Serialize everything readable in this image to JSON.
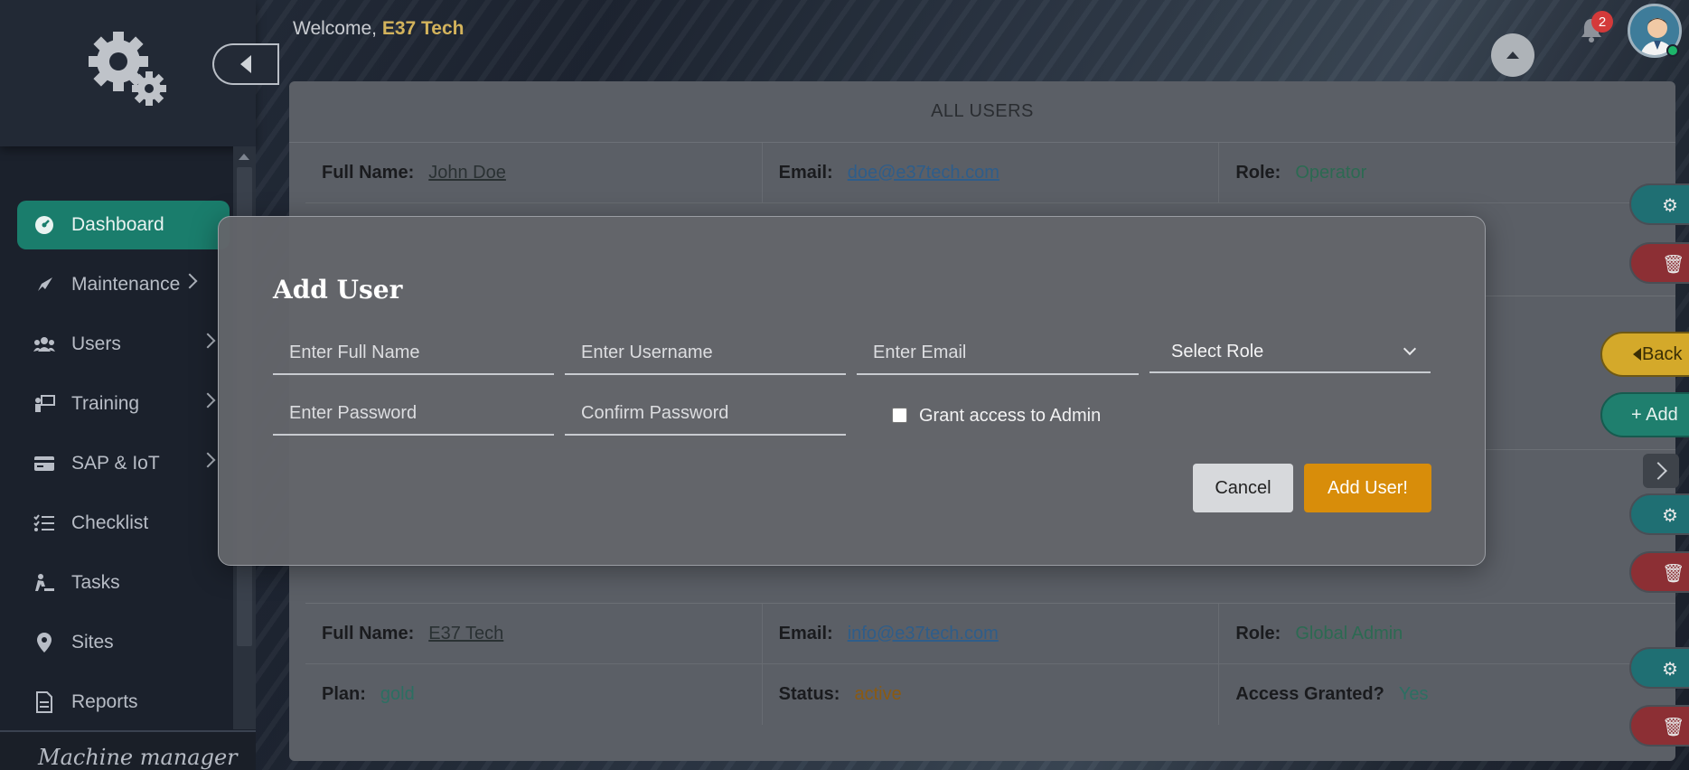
{
  "header": {
    "welcome_prefix": "Welcome,",
    "user_name": "E37 Tech",
    "notification_count": "2"
  },
  "sidebar": {
    "items": [
      {
        "label": "Dashboard",
        "icon": "dashboard-gauge-icon",
        "active": true
      },
      {
        "label": "Maintenance",
        "icon": "rocket-icon"
      },
      {
        "label": "Users",
        "icon": "users-icon"
      },
      {
        "label": "Training",
        "icon": "training-icon"
      },
      {
        "label": "SAP & IoT",
        "icon": "card-icon"
      },
      {
        "label": "Checklist",
        "icon": "checklist-icon"
      },
      {
        "label": "Tasks",
        "icon": "person-digging-icon"
      },
      {
        "label": "Sites",
        "icon": "map-pin-icon"
      },
      {
        "label": "Reports",
        "icon": "file-icon"
      }
    ],
    "footer_brand": "Machine manager"
  },
  "users_panel": {
    "title": "ALL USERS",
    "labels": {
      "full_name": "Full Name:",
      "email": "Email:",
      "role": "Role:",
      "plan": "Plan:",
      "status": "Status:",
      "access": "Access Granted?"
    },
    "users": [
      {
        "full_name": "John Doe",
        "email": "doe@e37tech.com",
        "role": "Operator"
      },
      {
        "full_name": "E37 Tech",
        "email": "info@e37tech.com",
        "role": "Global Admin",
        "plan": "gold",
        "status": "active",
        "access": "Yes"
      }
    ],
    "back_label": "Back",
    "add_label": "Add"
  },
  "modal": {
    "title": "Add User",
    "full_name_placeholder": "Enter Full Name",
    "username_placeholder": "Enter Username",
    "email_placeholder": "Enter Email",
    "role_placeholder": "Select Role",
    "password_placeholder": "Enter Password",
    "confirm_password_placeholder": "Confirm Password",
    "admin_checkbox_label": "Grant access to Admin",
    "admin_checked": false,
    "cancel_label": "Cancel",
    "submit_label": "Add User!"
  }
}
